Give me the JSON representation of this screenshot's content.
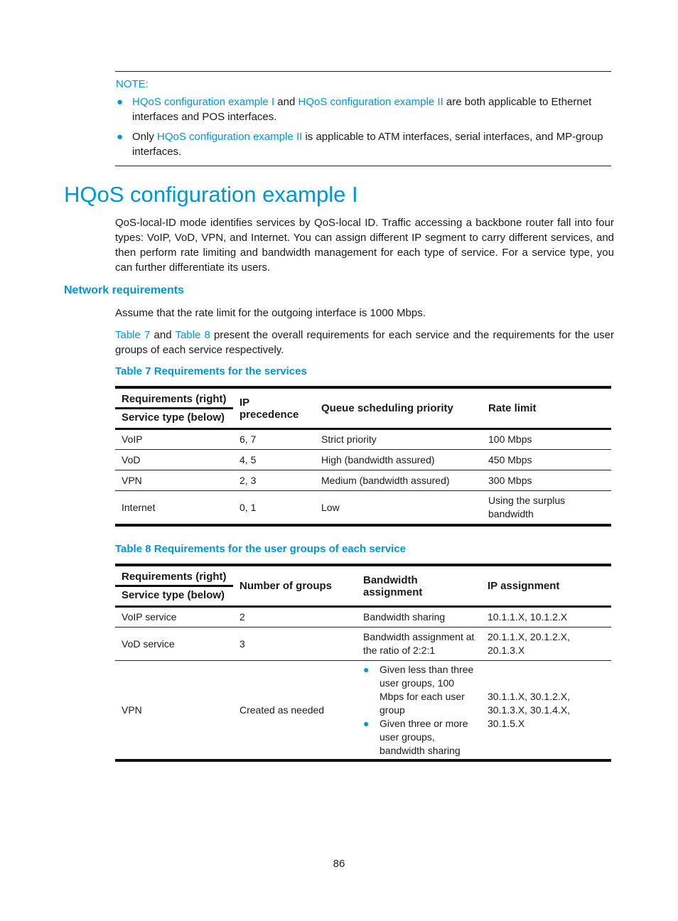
{
  "note": {
    "title": "NOTE:",
    "items": [
      {
        "link1": "HQoS configuration example I",
        "text1": " and ",
        "link2": "HQoS configuration example II",
        "text2": " are both applicable to Ethernet interfaces and POS interfaces."
      },
      {
        "text0": "Only ",
        "link1": "HQoS configuration example II",
        "text1": " is applicable to ATM interfaces, serial interfaces, and MP-group interfaces."
      }
    ]
  },
  "heading": "HQoS configuration example I",
  "intro": "QoS-local-ID mode identifies services by QoS-local ID. Traffic accessing a backbone router fall into four types: VoIP, VoD, VPN, and Internet. You can assign different IP segment to carry different services, and then perform rate limiting and bandwidth management for each type of service. For a service type, you can further differentiate its users.",
  "section": {
    "title": "Network requirements",
    "p1": "Assume that the rate limit for the outgoing interface is 1000 Mbps.",
    "p2": {
      "link1": "Table 7",
      "text1": " and ",
      "link2": "Table 8",
      "text2": " present the overall requirements for each service and the requirements for the user groups of each service respectively."
    }
  },
  "table7": {
    "caption": "Table 7 Requirements for the services",
    "corner_top": "Requirements (right)",
    "corner_bottom": "Service type (below)",
    "headers": [
      "IP precedence",
      "Queue scheduling priority",
      "Rate limit"
    ],
    "rows": [
      [
        "VoIP",
        "6, 7",
        "Strict priority",
        "100 Mbps"
      ],
      [
        "VoD",
        "4, 5",
        "High (bandwidth assured)",
        "450 Mbps"
      ],
      [
        "VPN",
        "2, 3",
        "Medium (bandwidth assured)",
        "300 Mbps"
      ],
      [
        "Internet",
        "0, 1",
        "Low",
        "Using the surplus bandwidth"
      ]
    ]
  },
  "table8": {
    "caption": "Table 8 Requirements for the user groups of each service",
    "corner_top": "Requirements (right)",
    "corner_bottom": "Service type (below)",
    "headers": [
      "Number of groups",
      "Bandwidth assignment",
      "IP assignment"
    ],
    "rows": [
      [
        "VoIP service",
        "2",
        "Bandwidth sharing",
        "10.1.1.X, 10.1.2.X"
      ],
      [
        "VoD service",
        "3",
        "Bandwidth assignment at the ratio of 2:2:1",
        "20.1.1.X, 20.1.2.X, 20.1.3.X"
      ],
      [
        "VPN",
        "Created as needed",
        "",
        "30.1.1.X, 30.1.2.X, 30.1.3.X, 30.1.4.X, 30.1.5.X"
      ]
    ],
    "vpn_bandwidth_items": [
      "Given less than three user groups, 100 Mbps for each user group",
      "Given three or more user groups, bandwidth sharing"
    ]
  },
  "page_number": "86",
  "colors": {
    "accent": "#0096d6",
    "text": "#1a1a1a"
  }
}
